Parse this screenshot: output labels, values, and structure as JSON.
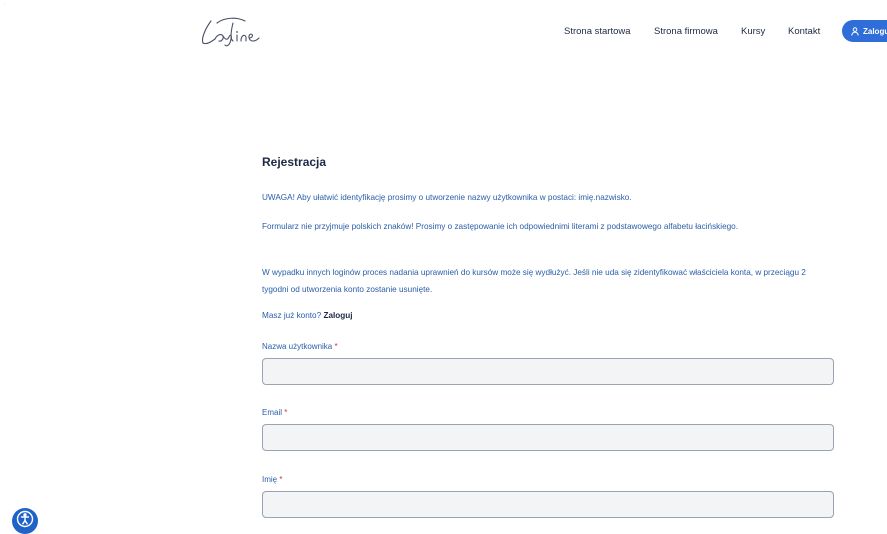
{
  "header": {
    "logo_text": "Laydine",
    "nav": [
      "Strona startowa",
      "Strona firmowa",
      "Kursy",
      "Kontakt"
    ],
    "login_label": "Zaloguj"
  },
  "form": {
    "title": "Rejestracja",
    "paragraphs": [
      "UWAGA! Aby ułatwić identyfikację prosimy o utworzenie nazwy użytkownika w postaci: imię.nazwisko.",
      "Formularz nie przyjmuje polskich znaków! Prosimy o zastępowanie ich odpowiednimi literami z podstawowego alfabetu łacińskiego.",
      "W wypadku innych loginów proces nadania uprawnień do kursów może się wydłużyć. Jeśli nie uda się zidentyfikować właściciela konta, w przeciągu 2 tygodni od utworzenia konto zostanie usunięte."
    ],
    "have_account": "Masz już konto?",
    "login_link": "Zaloguj",
    "required_mark": "*",
    "fields": [
      {
        "label": "Nazwa użytkownika",
        "value": ""
      },
      {
        "label": "Email",
        "value": ""
      },
      {
        "label": "Imię",
        "value": ""
      }
    ]
  },
  "colors": {
    "accent": "#2f6ed8",
    "text_blue": "#2a5ea8",
    "heading": "#1d2a44",
    "required": "#d0312d"
  },
  "icons": [
    "user-icon",
    "accessibility-icon"
  ]
}
